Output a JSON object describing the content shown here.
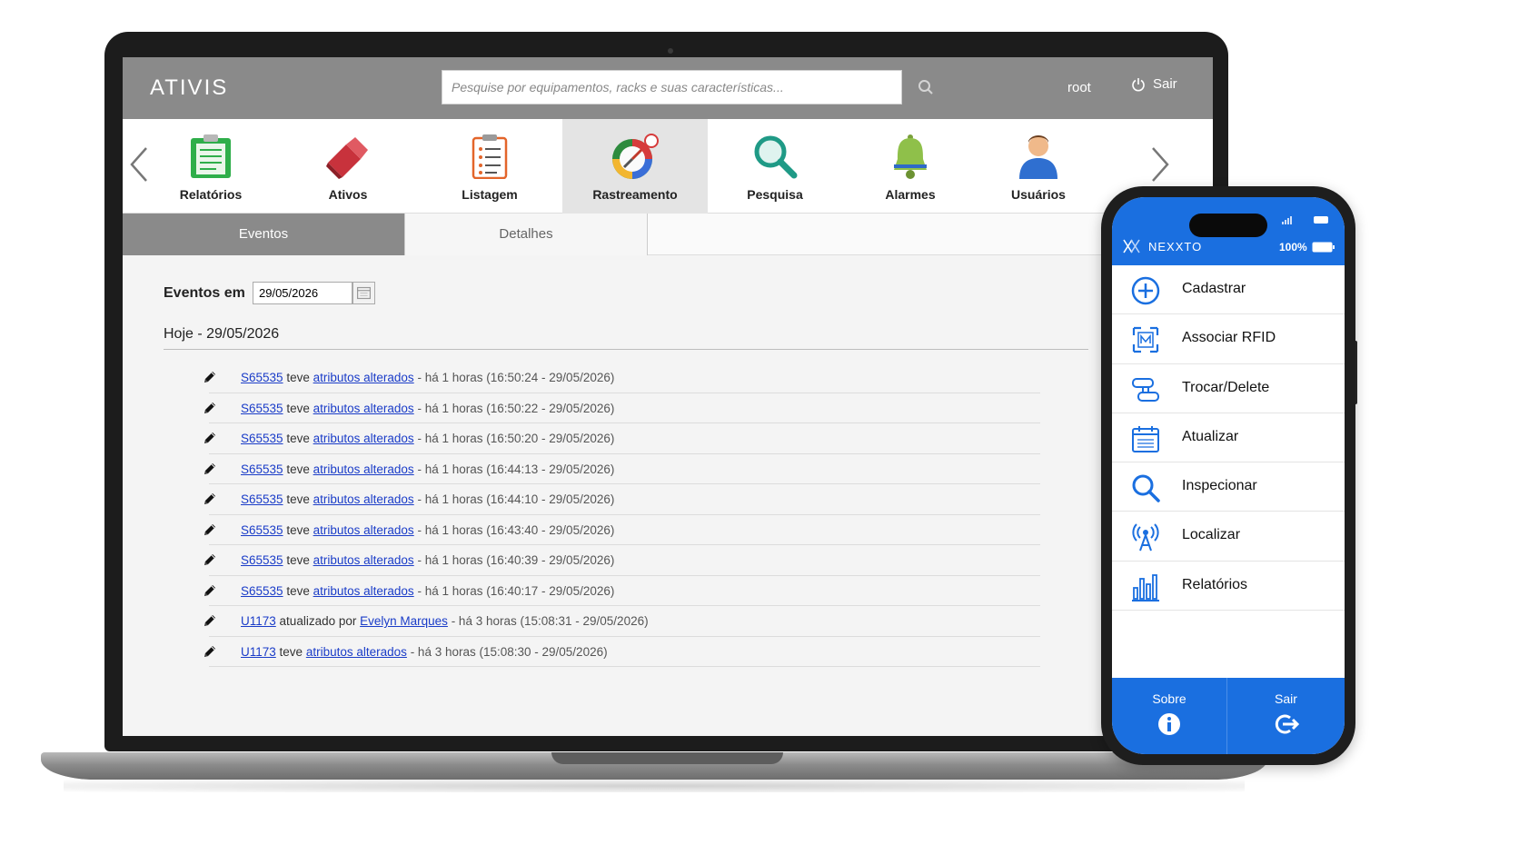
{
  "laptop": {
    "app": {
      "logo": "ATIVIS",
      "search_placeholder": "Pesquise por equipamentos, racks e suas características...",
      "user": "root",
      "logout_label": "Sair"
    },
    "toolbar": [
      {
        "label": "Relatórios",
        "icon": "clipboard-icon"
      },
      {
        "label": "Ativos",
        "icon": "usb-stick-icon"
      },
      {
        "label": "Listagem",
        "icon": "list-icon"
      },
      {
        "label": "Rastreamento",
        "icon": "tracking-compass-icon",
        "active": true
      },
      {
        "label": "Pesquisa",
        "icon": "magnifier-icon"
      },
      {
        "label": "Alarmes",
        "icon": "bell-icon"
      },
      {
        "label": "Usuários",
        "icon": "user-icon"
      }
    ],
    "tabs": [
      {
        "label": "Eventos",
        "active": true
      },
      {
        "label": "Detalhes",
        "active": false
      }
    ],
    "events_filter": {
      "label": "Eventos em",
      "date": "29/05/2026"
    },
    "day_heading": "Hoje - 29/05/2026",
    "events": [
      {
        "asset": "S65535",
        "verb": "teve",
        "link": "atributos alterados",
        "time": "- há 1 horas (16:50:24 - 29/05/2026)"
      },
      {
        "asset": "S65535",
        "verb": "teve",
        "link": "atributos alterados",
        "time": "- há 1 horas (16:50:22 - 29/05/2026)"
      },
      {
        "asset": "S65535",
        "verb": "teve",
        "link": "atributos alterados",
        "time": "- há 1 horas (16:50:20 - 29/05/2026)"
      },
      {
        "asset": "S65535",
        "verb": "teve",
        "link": "atributos alterados",
        "time": "- há 1 horas (16:44:13 - 29/05/2026)"
      },
      {
        "asset": "S65535",
        "verb": "teve",
        "link": "atributos alterados",
        "time": "- há 1 horas (16:44:10 - 29/05/2026)"
      },
      {
        "asset": "S65535",
        "verb": "teve",
        "link": "atributos alterados",
        "time": "- há 1 horas (16:43:40 - 29/05/2026)"
      },
      {
        "asset": "S65535",
        "verb": "teve",
        "link": "atributos alterados",
        "time": "- há 1 horas (16:40:39 - 29/05/2026)"
      },
      {
        "asset": "S65535",
        "verb": "teve",
        "link": "atributos alterados",
        "time": "- há 1 horas (16:40:17 - 29/05/2026)"
      },
      {
        "asset": "U1173",
        "verb": "atualizado por",
        "link": "Evelyn Marques",
        "time": "- há 3 horas (15:08:31 - 29/05/2026)"
      },
      {
        "asset": "U1173",
        "verb": "teve",
        "link": "atributos alterados",
        "time": "- há 3 horas (15:08:30 - 29/05/2026)"
      }
    ]
  },
  "phone": {
    "brand": "NEXXTO",
    "battery": "100%",
    "menu": [
      {
        "label": "Cadastrar",
        "icon": "plus-circle-icon"
      },
      {
        "label": "Associar RFID",
        "icon": "rfid-tag-icon"
      },
      {
        "label": "Trocar/Delete",
        "icon": "swap-icon"
      },
      {
        "label": "Atualizar",
        "icon": "calendar-icon"
      },
      {
        "label": "Inspecionar",
        "icon": "search-icon"
      },
      {
        "label": "Localizar",
        "icon": "antenna-icon"
      },
      {
        "label": "Relatórios",
        "icon": "bar-chart-icon"
      }
    ],
    "footer": [
      {
        "label": "Sobre",
        "icon": "info-icon"
      },
      {
        "label": "Sair",
        "icon": "exit-icon"
      }
    ]
  },
  "colors": {
    "topbar": "#8a8a8a",
    "phone_accent": "#1a6fe0",
    "link": "#1a3cc8"
  }
}
